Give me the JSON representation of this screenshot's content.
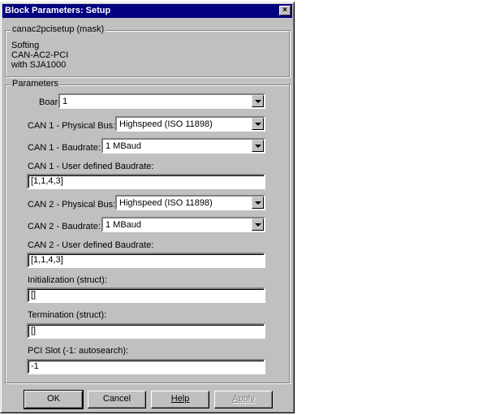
{
  "window": {
    "title": "Block Parameters: Setup",
    "close_glyph": "×"
  },
  "mask_group": {
    "title": "canac2pcisetup (mask)",
    "lines": [
      "Softing",
      "CAN-AC2-PCI",
      "with SJA1000"
    ]
  },
  "params_group": {
    "title": "Parameters"
  },
  "board": {
    "label": "Board:",
    "value": "1"
  },
  "can1_bus": {
    "label": "CAN 1 - Physical Bus:",
    "value": "Highspeed (ISO 11898)"
  },
  "can1_baud": {
    "label": "CAN 1 - Baudrate:",
    "value": "1 MBaud"
  },
  "can1_user_baud": {
    "label": "CAN 1 - User defined Baudrate:",
    "value": "[1,1,4,3]"
  },
  "can2_bus": {
    "label": "CAN 2 - Physical Bus:",
    "value": "Highspeed (ISO 11898)"
  },
  "can2_baud": {
    "label": "CAN 2 - Baudrate:",
    "value": "1 MBaud"
  },
  "can2_user_baud": {
    "label": "CAN 2 - User defined Baudrate:",
    "value": "[1,1,4,3]"
  },
  "init": {
    "label": "Initialization (struct):",
    "value": "[]"
  },
  "term": {
    "label": "Termination (struct):",
    "value": "[]"
  },
  "pci_slot": {
    "label": "PCI Slot (-1: autosearch):",
    "value": "-1"
  },
  "buttons": {
    "ok": "OK",
    "cancel": "Cancel",
    "help": "Help",
    "apply": "Apply"
  }
}
